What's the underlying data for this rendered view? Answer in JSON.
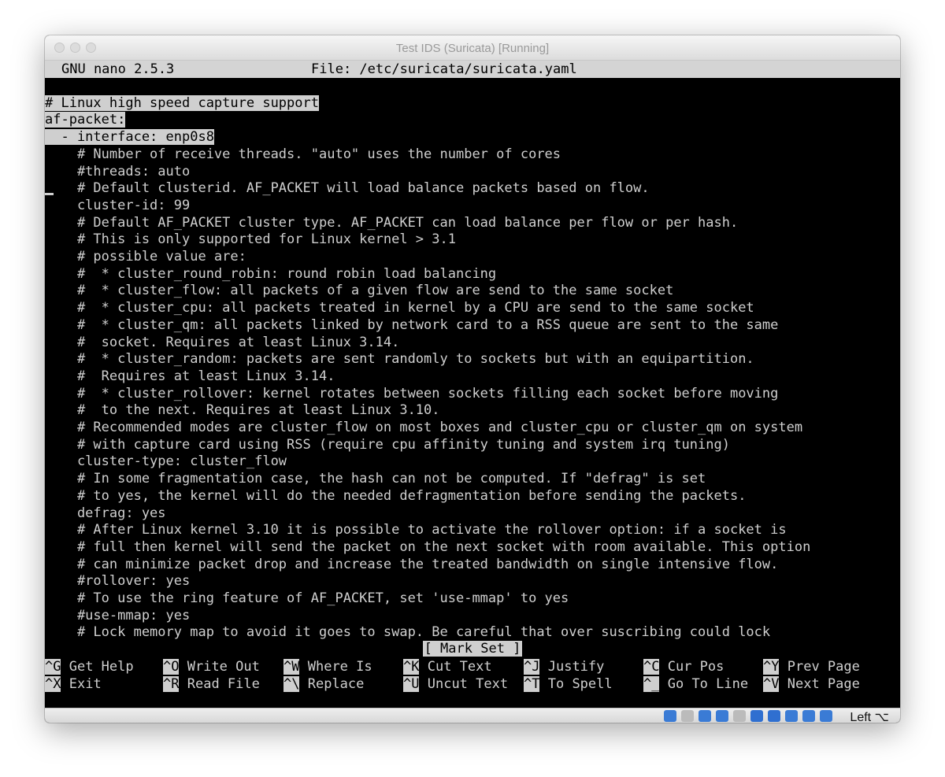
{
  "window": {
    "title": "Test IDS (Suricata) [Running]"
  },
  "nano": {
    "version": "GNU nano 2.5.3",
    "file_label": "File: /etc/suricata/suricata.yaml"
  },
  "lines": [
    "",
    "# Linux high speed capture support",
    "af-packet:",
    "  - interface: enp0s8",
    "    # Number of receive threads. \"auto\" uses the number of cores",
    "    #threads: auto",
    "    # Default clusterid. AF_PACKET will load balance packets based on flow.",
    "    cluster-id: 99",
    "    # Default AF_PACKET cluster type. AF_PACKET can load balance per flow or per hash.",
    "    # This is only supported for Linux kernel > 3.1",
    "    # possible value are:",
    "    #  * cluster_round_robin: round robin load balancing",
    "    #  * cluster_flow: all packets of a given flow are send to the same socket",
    "    #  * cluster_cpu: all packets treated in kernel by a CPU are send to the same socket",
    "    #  * cluster_qm: all packets linked by network card to a RSS queue are sent to the same",
    "    #  socket. Requires at least Linux 3.14.",
    "    #  * cluster_random: packets are sent randomly to sockets but with an equipartition.",
    "    #  Requires at least Linux 3.14.",
    "    #  * cluster_rollover: kernel rotates between sockets filling each socket before moving",
    "    #  to the next. Requires at least Linux 3.10.",
    "    # Recommended modes are cluster_flow on most boxes and cluster_cpu or cluster_qm on system",
    "    # with capture card using RSS (require cpu affinity tuning and system irq tuning)",
    "    cluster-type: cluster_flow",
    "    # In some fragmentation case, the hash can not be computed. If \"defrag\" is set",
    "    # to yes, the kernel will do the needed defragmentation before sending the packets.",
    "    defrag: yes",
    "    # After Linux kernel 3.10 it is possible to activate the rollover option: if a socket is",
    "    # full then kernel will send the packet on the next socket with room available. This option",
    "    # can minimize packet drop and increase the treated bandwidth on single intensive flow.",
    "    #rollover: yes",
    "    # To use the ring feature of AF_PACKET, set 'use-mmap' to yes",
    "    #use-mmap: yes",
    "    # Lock memory map to avoid it goes to swap. Be careful that over suscribing could lock"
  ],
  "status_message": "[ Mark Set ]",
  "shortcuts_row1": [
    {
      "key": "^G",
      "label": "Get Help"
    },
    {
      "key": "^O",
      "label": "Write Out"
    },
    {
      "key": "^W",
      "label": "Where Is"
    },
    {
      "key": "^K",
      "label": "Cut Text"
    },
    {
      "key": "^J",
      "label": "Justify"
    },
    {
      "key": "^C",
      "label": "Cur Pos"
    },
    {
      "key": "^Y",
      "label": "Prev Page"
    }
  ],
  "shortcuts_row2": [
    {
      "key": "^X",
      "label": "Exit"
    },
    {
      "key": "^R",
      "label": "Read File"
    },
    {
      "key": "^\\",
      "label": "Replace"
    },
    {
      "key": "^U",
      "label": "Uncut Text"
    },
    {
      "key": "^T",
      "label": "To Spell"
    },
    {
      "key": "^_",
      "label": "Go To Line"
    },
    {
      "key": "^V",
      "label": "Next Page"
    }
  ],
  "vbox": {
    "host_key": "Left ⌥",
    "icons": [
      "hard-disk-icon",
      "optical-drive-icon",
      "audio-icon",
      "usb-icon",
      "shared-folder-icon",
      "display-icon",
      "network-icon",
      "recording-icon",
      "cpu-icon",
      "mouse-integration-icon"
    ]
  }
}
